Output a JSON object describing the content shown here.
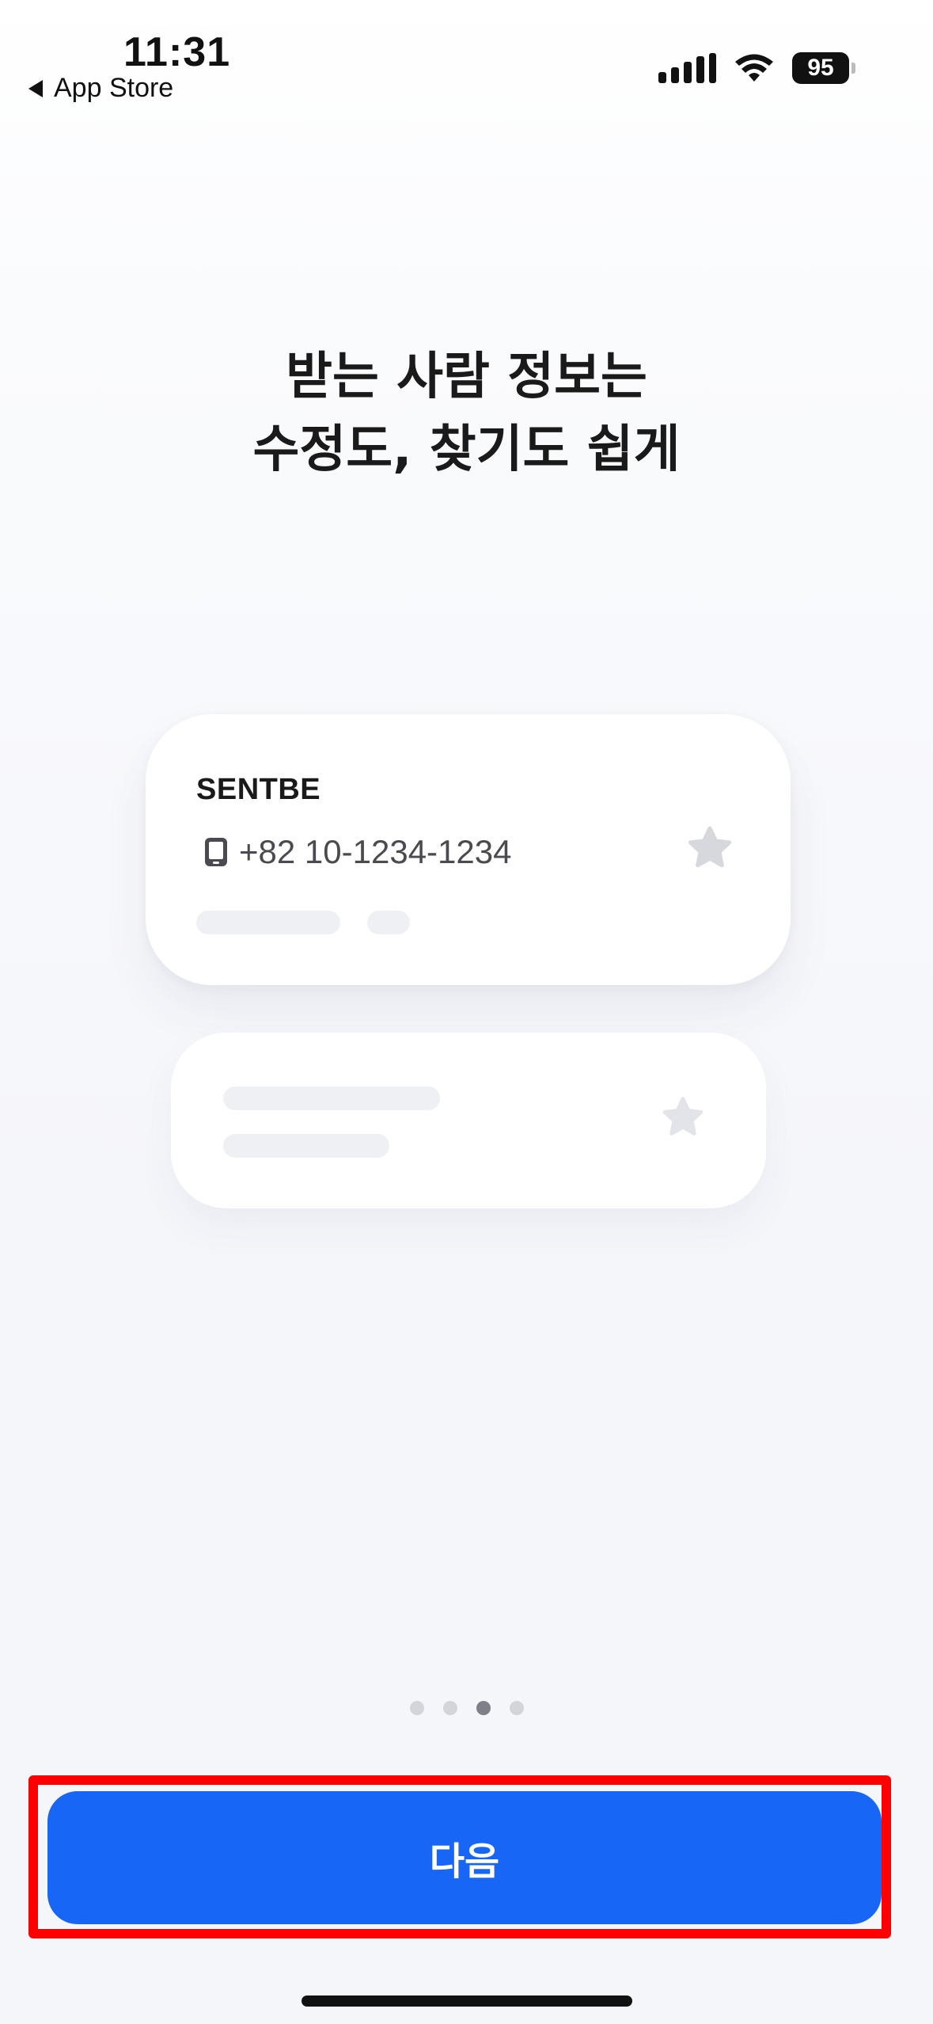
{
  "status_bar": {
    "time": "11:31",
    "back_label": "App Store",
    "battery": "95"
  },
  "headline": {
    "line1": "받는 사람 정보는",
    "line2": "수정도, 찾기도 쉽게"
  },
  "recipient_card": {
    "name": "SENTBE",
    "phone": "+82 10-1234-1234"
  },
  "pagination": {
    "total": 4,
    "current": 3
  },
  "next_button": {
    "label": "다음"
  },
  "colors": {
    "primary": "#1866f6",
    "highlight": "#ff0000"
  }
}
